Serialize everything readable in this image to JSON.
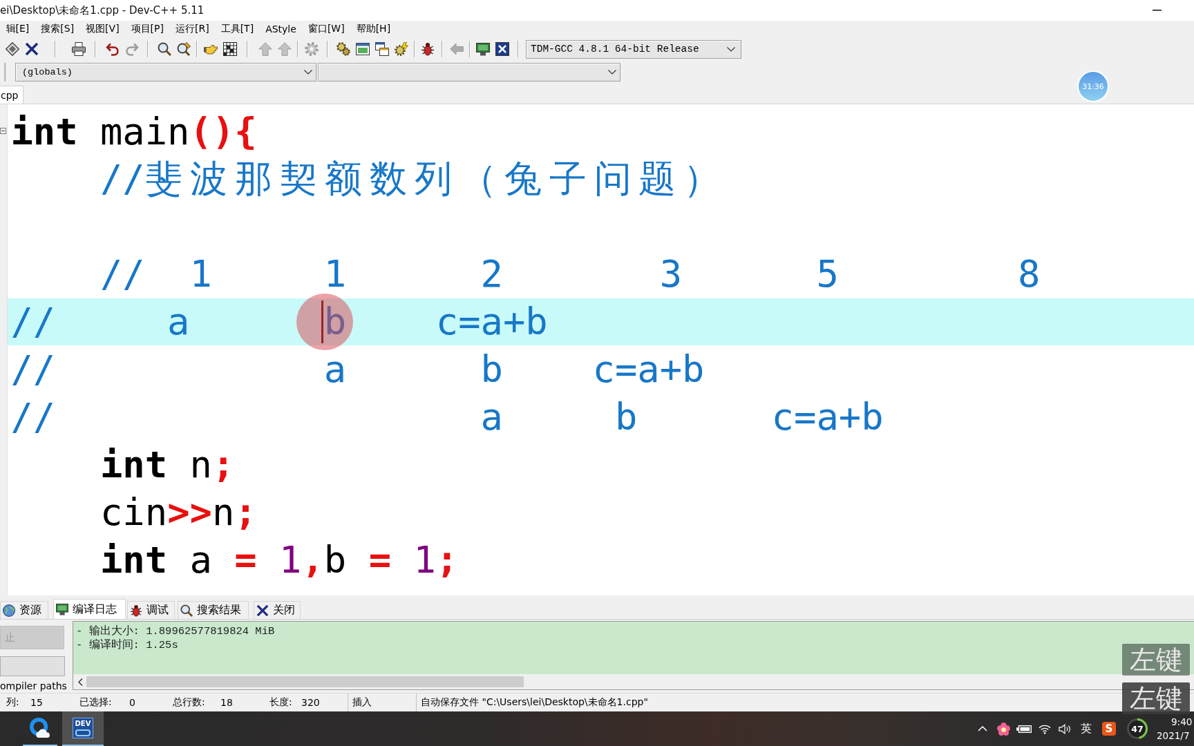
{
  "window": {
    "title": "ei\\Desktop\\未命名1.cpp - Dev-C++ 5.11"
  },
  "menu": [
    "辑[E]",
    "搜索[S]",
    "视图[V]",
    "项目[P]",
    "运行[R]",
    "工具[T]",
    "AStyle",
    "窗口[W]",
    "帮助[H]"
  ],
  "toolbar": {
    "groups": [
      [
        {
          "disabled": false
        },
        {
          "disabled": false
        }
      ],
      [
        {
          "disabled": false
        }
      ],
      [
        {
          "disabled": false
        },
        {
          "disabled": true
        }
      ],
      [
        {
          "disabled": false
        },
        {
          "disabled": false
        }
      ],
      [
        {
          "disabled": false
        },
        {
          "disabled": false
        }
      ],
      [
        {
          "disabled": true
        },
        {
          "disabled": true
        }
      ],
      [
        {
          "disabled": true
        }
      ],
      [
        {
          "disabled": false
        },
        {
          "disabled": false
        },
        {
          "disabled": false
        },
        {
          "disabled": false
        }
      ],
      [
        {
          "disabled": false
        }
      ],
      [
        {
          "disabled": true
        }
      ],
      [
        {
          "disabled": false
        },
        {
          "disabled": false
        }
      ]
    ],
    "compiler": "TDM-GCC 4.8.1 64-bit Release"
  },
  "class_bar": {
    "scope": "(globals)"
  },
  "file_tabs": [
    {
      "label": "cpp",
      "selected": true
    }
  ],
  "editor": {
    "lines": [
      {
        "highlighted": false,
        "tokens": [
          {
            "kind": "keyword",
            "text": "int"
          },
          {
            "kind": "plain",
            "text": " main"
          },
          {
            "kind": "symbol",
            "text": "(){"
          }
        ]
      },
      {
        "highlighted": false,
        "tokens": [
          {
            "kind": "comment",
            "text": "    //斐波那契额数列（兔子问题）"
          }
        ]
      },
      {
        "highlighted": false
      },
      {
        "highlighted": false,
        "tokens": [
          {
            "kind": "comment",
            "text": "    //  1     1      2       3      5        8"
          }
        ]
      },
      {
        "highlighted": true,
        "tokens": [
          {
            "kind": "comment",
            "text": "//     a      "
          },
          {
            "kind": "caret",
            "clicked": true
          },
          {
            "kind": "comment",
            "text": "b    c=a+b"
          }
        ]
      },
      {
        "highlighted": false,
        "tokens": [
          {
            "kind": "comment",
            "text": "//            a      b    c=a+b"
          }
        ]
      },
      {
        "highlighted": false,
        "tokens": [
          {
            "kind": "comment",
            "text": "//                   a     b      c=a+b"
          }
        ]
      },
      {
        "highlighted": false,
        "tokens": [
          {
            "kind": "keyword",
            "text": "    int"
          },
          {
            "kind": "plain",
            "text": " n"
          },
          {
            "kind": "symbol",
            "text": ";"
          }
        ]
      },
      {
        "highlighted": false,
        "tokens": [
          {
            "kind": "plain",
            "text": "    cin"
          },
          {
            "kind": "symbol",
            "text": ">>"
          },
          {
            "kind": "plain",
            "text": "n"
          },
          {
            "kind": "symbol",
            "text": ";"
          }
        ]
      },
      {
        "highlighted": false,
        "tokens": [
          {
            "kind": "keyword",
            "text": "    int"
          },
          {
            "kind": "plain",
            "text": " a "
          },
          {
            "kind": "symbol",
            "text": "="
          },
          {
            "kind": "number",
            "text": " 1"
          },
          {
            "kind": "symbol",
            "text": ","
          },
          {
            "kind": "plain",
            "text": "b "
          },
          {
            "kind": "symbol",
            "text": "="
          },
          {
            "kind": "number",
            "text": " 1"
          },
          {
            "kind": "symbol",
            "text": ";"
          }
        ]
      }
    ]
  },
  "bottom_panel": {
    "tabs": [
      {
        "label": "资源",
        "selected": false
      },
      {
        "label": "编译日志",
        "selected": true
      },
      {
        "label": "调试",
        "selected": false
      },
      {
        "label": "搜索结果",
        "selected": false
      },
      {
        "label": "关闭",
        "selected": false
      }
    ],
    "buttons": [
      {
        "label": "止",
        "disabled": true
      },
      {
        "disabled": false
      }
    ],
    "side_text": "ompiler paths",
    "log": [
      "- 输出大小: 1.89962577819824 MiB",
      "- 编译时间: 1.25s"
    ]
  },
  "status_bar": [
    {
      "label": "列:",
      "value": "15"
    },
    {
      "label": "已选择:",
      "value": "0"
    },
    {
      "label": "总行数:",
      "value": "18"
    },
    {
      "label": "长度:",
      "value": "320"
    },
    {
      "label": "插入"
    },
    {
      "label": "自动保存文件 \"C:\\Users\\lei\\Desktop\\未命名1.cpp\""
    }
  ],
  "taskbar": {
    "apps": [
      {
        "active": false
      },
      {
        "logo": "DEV",
        "active": true
      }
    ],
    "tray": {
      "input_mode": "英",
      "ime_logo": "S",
      "meter": {
        "reading": "47",
        "level": 0.47
      },
      "time": "9:40",
      "date": "2021/7"
    }
  },
  "overlays": {
    "timer": "31:36",
    "key_presses": [
      {
        "label": "左键",
        "faded": true
      },
      {
        "label": "左键",
        "faded": false
      }
    ]
  }
}
